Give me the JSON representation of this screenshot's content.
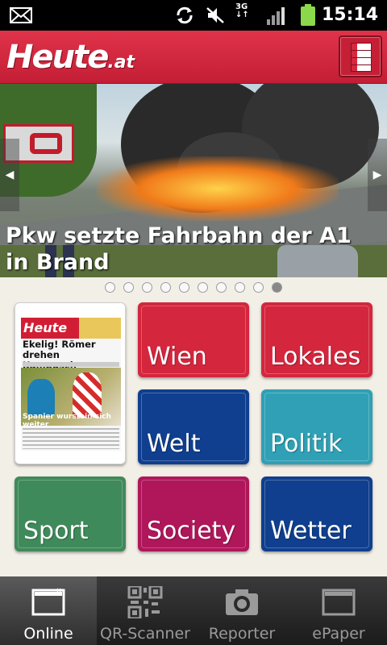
{
  "status_bar": {
    "time": "15:14",
    "network": "3G",
    "icons": [
      "mail-icon",
      "sync-icon",
      "mute-icon",
      "3g-icon",
      "signal-icon",
      "battery-icon"
    ]
  },
  "header": {
    "logo": "Heute",
    "logo_tld": ".at",
    "menu_icon": "menu-icon",
    "color": "#d4263d"
  },
  "hero": {
    "caption": "Pkw setzte Fahrbahn der A1 in Brand",
    "slide_count": 10,
    "active_slide": 10
  },
  "paper_thumb": {
    "masthead": "Heute",
    "headline": "Ekelig! Römer drehen Kampusch-Horrorfilm",
    "photo_caption": "Spanier wurstein sich weiter"
  },
  "tiles": [
    {
      "label": "Wien",
      "color": "#d4263d"
    },
    {
      "label": "Lokales",
      "color": "#d4263d"
    },
    {
      "label": "Welt",
      "color": "#0f3f8e"
    },
    {
      "label": "Politik",
      "color": "#2fa0b5"
    },
    {
      "label": "Sport",
      "color": "#3f8a5a"
    },
    {
      "label": "Society",
      "color": "#b0165a"
    },
    {
      "label": "Wetter",
      "color": "#0f3f8e"
    }
  ],
  "tabs": [
    {
      "label": "Online",
      "icon": "folder-icon",
      "active": true
    },
    {
      "label": "QR-Scanner",
      "icon": "qr-code-icon",
      "active": false
    },
    {
      "label": "Reporter",
      "icon": "camera-icon",
      "active": false
    },
    {
      "label": "ePaper",
      "icon": "epaper-icon",
      "active": false
    }
  ]
}
